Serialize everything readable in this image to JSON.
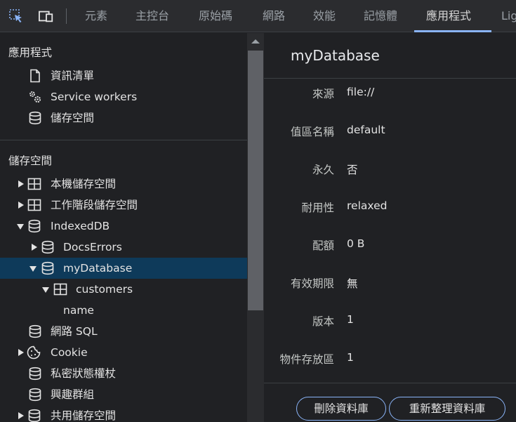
{
  "toolbar": {
    "tabs": [
      "元素",
      "主控台",
      "原始碼",
      "網路",
      "效能",
      "記憶體",
      "應用程式",
      "Lig"
    ],
    "active_tab": "應用程式",
    "icons": [
      "inspect-element-icon",
      "device-toolbar-icon"
    ]
  },
  "sidebar": {
    "app_section": {
      "title": "應用程式",
      "items": [
        {
          "label": "資訊清單",
          "icon": "document-icon"
        },
        {
          "label": "Service workers",
          "icon": "gears-icon"
        },
        {
          "label": "儲存空間",
          "icon": "database-icon"
        }
      ]
    },
    "storage_section": {
      "title": "儲存空間",
      "items": [
        {
          "label": "本機儲存空間",
          "icon": "table-icon",
          "expander": "collapsed"
        },
        {
          "label": "工作階段儲存空間",
          "icon": "table-icon",
          "expander": "collapsed"
        },
        {
          "label": "IndexedDB",
          "icon": "database-icon",
          "expander": "expanded"
        },
        {
          "label": "DocsErrors",
          "icon": "database-icon",
          "expander": "collapsed"
        },
        {
          "label": "myDatabase",
          "icon": "database-icon",
          "expander": "expanded",
          "selected": true
        },
        {
          "label": "customers",
          "icon": "table-icon",
          "expander": "expanded"
        },
        {
          "label": "name"
        },
        {
          "label": "網路 SQL",
          "icon": "database-icon"
        },
        {
          "label": "Cookie",
          "icon": "cookie-icon",
          "expander": "collapsed"
        },
        {
          "label": "私密狀態權杖",
          "icon": "database-icon"
        },
        {
          "label": "興趣群組",
          "icon": "database-icon"
        },
        {
          "label": "共用儲存空間",
          "icon": "database-icon",
          "expander": "collapsed"
        }
      ]
    }
  },
  "main": {
    "title": "myDatabase",
    "properties": [
      {
        "label": "來源",
        "value": "file://"
      },
      {
        "label": "值區名稱",
        "value": "default"
      },
      {
        "label": "永久",
        "value": "否"
      },
      {
        "label": "耐用性",
        "value": "relaxed"
      },
      {
        "label": "配額",
        "value": "0 B"
      },
      {
        "label": "有效期限",
        "value": "無"
      },
      {
        "label": "版本",
        "value": "1"
      },
      {
        "label": "物件存放區",
        "value": "1"
      }
    ],
    "buttons": {
      "delete_label": "刪除資料庫",
      "refresh_label": "重新整理資料庫"
    }
  },
  "colors": {
    "accent": "#8ab4f8",
    "selected_row": "#0e3a5a",
    "background": "#202124",
    "toolbar": "#2b2c2f"
  }
}
